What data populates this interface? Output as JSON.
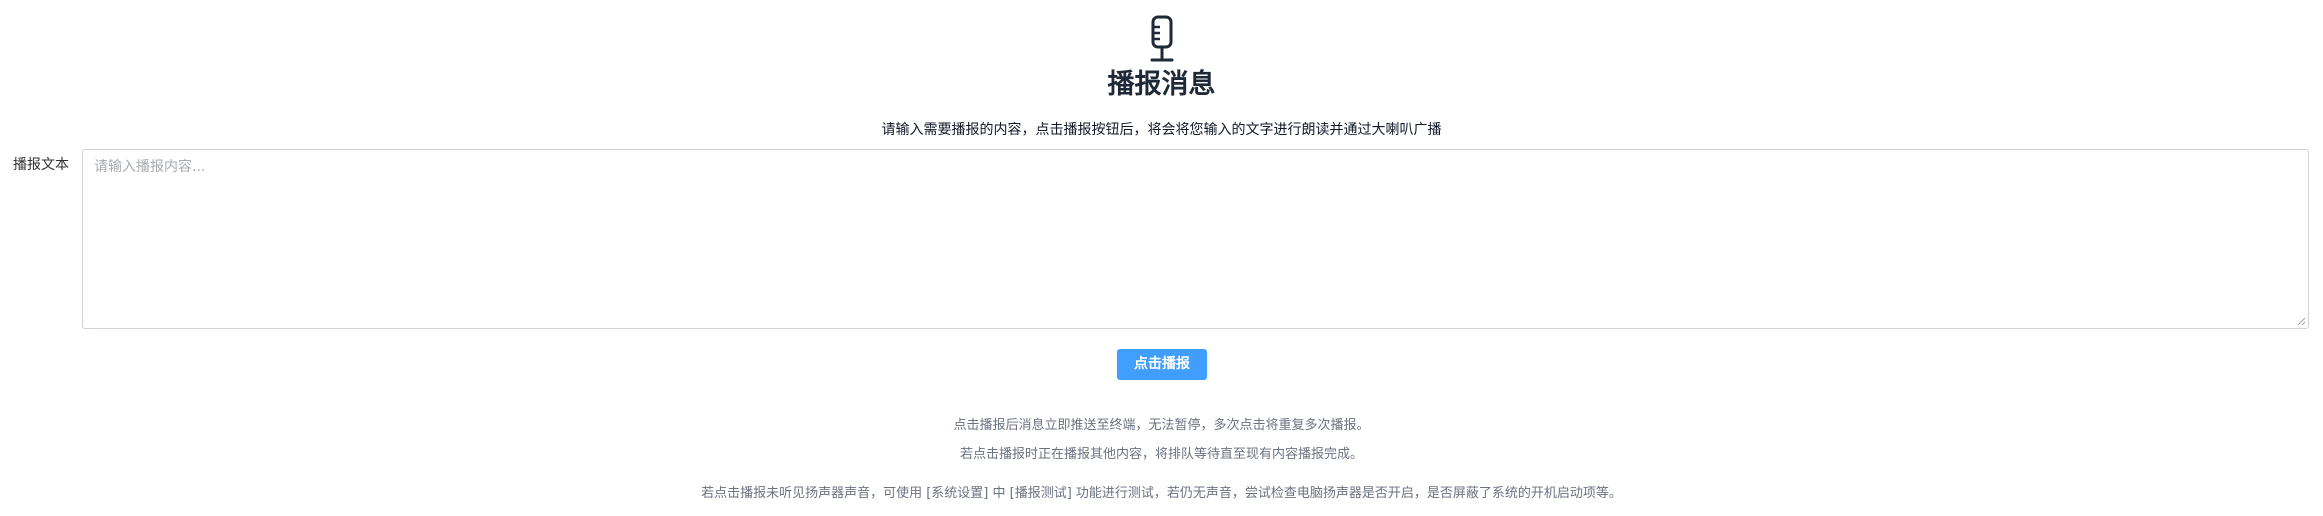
{
  "header": {
    "icon": "microphone-icon",
    "title": "播报消息",
    "description": "请输入需要播报的内容，点击播报按钮后，将会将您输入的文字进行朗读并通过大喇叭广播"
  },
  "form": {
    "label": "播报文本",
    "placeholder": "请输入播报内容...",
    "value": ""
  },
  "actions": {
    "broadcast_label": "点击播报",
    "button_color": "#409eff"
  },
  "notes": [
    "点击播报后消息立即推送至终端，无法暂停，多次点击将重复多次播报。",
    "若点击播报时正在播报其他内容，将排队等待直至现有内容播报完成。",
    "若点击播报未听见扬声器声音，可使用 [系统设置] 中 [播报测试] 功能进行测试，若仍无声音，尝试检查电脑扬声器是否开启，是否屏蔽了系统的开机启动项等。"
  ]
}
